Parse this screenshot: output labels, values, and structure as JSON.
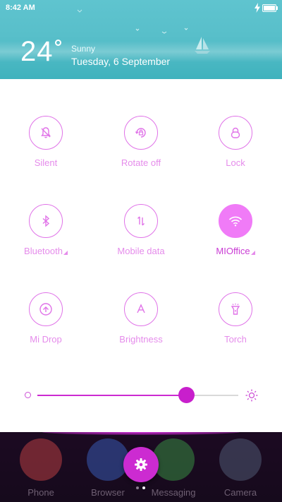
{
  "status_bar": {
    "time": "8:42 AM"
  },
  "weather": {
    "temperature": "24",
    "condition": "Sunny",
    "date": "Tuesday, 6 September"
  },
  "toggles": [
    {
      "label": "Silent",
      "icon": "bell-off-icon",
      "active": false
    },
    {
      "label": "Rotate off",
      "icon": "rotate-lock-icon",
      "active": false
    },
    {
      "label": "Lock",
      "icon": "lock-icon",
      "active": false
    },
    {
      "label": "Bluetooth",
      "icon": "bluetooth-icon",
      "active": false,
      "expandable": true
    },
    {
      "label": "Mobile data",
      "icon": "mobile-data-icon",
      "active": false
    },
    {
      "label": "MIOffice",
      "icon": "wifi-icon",
      "active": true,
      "expandable": true
    },
    {
      "label": "Mi Drop",
      "icon": "mi-drop-icon",
      "active": false
    },
    {
      "label": "Brightness",
      "icon": "brightness-auto-icon",
      "active": false
    },
    {
      "label": "Torch",
      "icon": "torch-icon",
      "active": false
    }
  ],
  "brightness": {
    "level": 0.74
  },
  "dock": {
    "apps": [
      {
        "label": "Phone",
        "color": "#d94a4a"
      },
      {
        "label": "Browser",
        "color": "#3f6bd1"
      },
      {
        "label": "Messaging",
        "color": "#3fa84a"
      },
      {
        "label": "Camera",
        "color": "#5a6b86"
      }
    ]
  },
  "colors": {
    "accent": "#cc2bd1",
    "toggle_outline": "#e073e8",
    "active_toggle": "#f07bf7",
    "header": "#5fc4cf"
  }
}
